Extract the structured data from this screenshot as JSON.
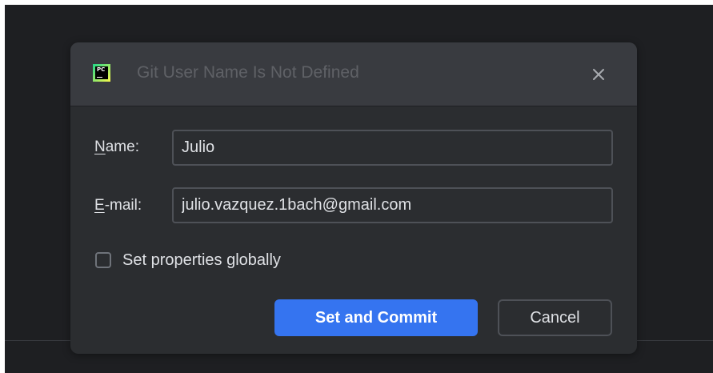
{
  "dialog": {
    "title": "Git User Name Is Not Defined",
    "app_icon_text": "PC",
    "close_icon": "close-icon",
    "name_label_mnemonic": "N",
    "name_label_rest": "ame:",
    "name_value": "Julio",
    "email_label_mnemonic": "E",
    "email_label_rest": "-mail:",
    "email_value": "julio.vazquez.1bach@gmail.com",
    "checkbox_label": "Set properties globally",
    "checkbox_checked": false,
    "primary_button": "Set and Commit",
    "cancel_button": "Cancel"
  },
  "colors": {
    "background": "#1e1f22",
    "dialog": "#2b2d30",
    "titlebar": "#393b40",
    "accent": "#3574f0",
    "text": "#dfe1e5",
    "title_text": "#5f6166"
  }
}
